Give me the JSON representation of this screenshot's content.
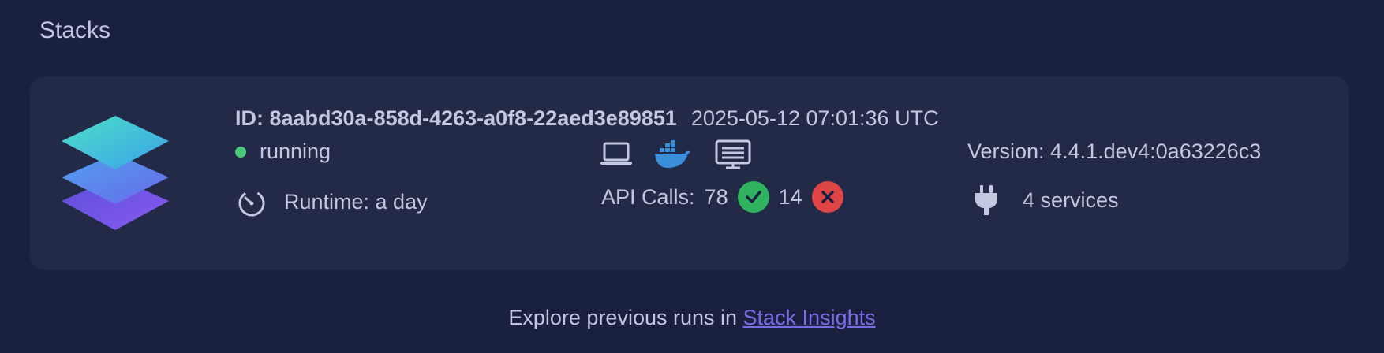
{
  "section": {
    "title": "Stacks"
  },
  "stack": {
    "id_label": "ID: 8aabd30a-858d-4263-a0f8-22aed3e89851",
    "timestamp": "2025-05-12 07:01:36 UTC",
    "status": "running",
    "status_color": "#4cc77a",
    "runtime": "Runtime: a day",
    "api_calls_label": "API Calls:",
    "api_success": "78",
    "api_errors": "14",
    "success_color": "#2fb35f",
    "error_color": "#e04545",
    "version": "Version: 4.4.1.dev4:0a63226c3",
    "services": "4 services",
    "icons": [
      "laptop-icon",
      "docker-icon",
      "server-icon"
    ]
  },
  "footer": {
    "prefix": "Explore previous runs in ",
    "link": "Stack Insights"
  }
}
